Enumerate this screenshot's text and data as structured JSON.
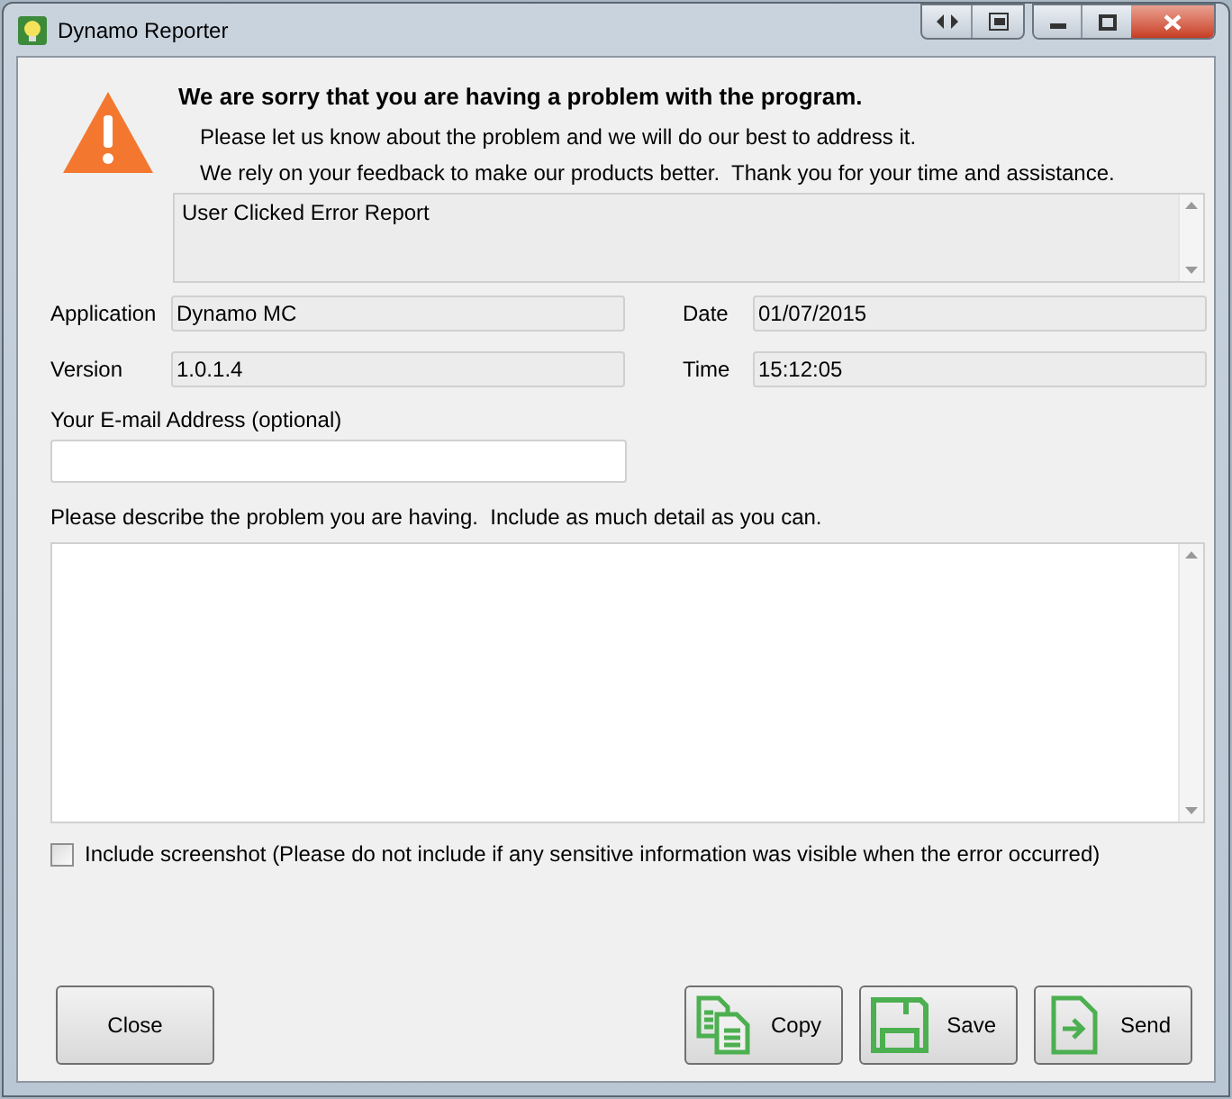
{
  "window": {
    "title": "Dynamo Reporter"
  },
  "header": {
    "heading": "We are sorry that you are having a problem with the program.",
    "lines": [
      "Please let us know about the problem and we will do our best to address it.",
      "We rely on your feedback to make our products better.  Thank you for your time and assistance."
    ]
  },
  "error_details": {
    "value": "User Clicked Error Report"
  },
  "info_fields": [
    {
      "label": "Application",
      "value": "Dynamo MC"
    },
    {
      "label": "Date",
      "value": "01/07/2015"
    },
    {
      "label": "Version",
      "value": "1.0.1.4"
    },
    {
      "label": "Time",
      "value": "15:12:05"
    }
  ],
  "email": {
    "label": "Your E-mail Address (optional)"
  },
  "description": {
    "label": "Please describe the problem you are having.  Include as much detail as you can."
  },
  "screenshot_option": {
    "label": "Include screenshot (Please do not include if any sensitive information was visible when the error occurred)",
    "checked": false
  },
  "buttons": [
    {
      "label": "Close",
      "kind": "plain"
    },
    {
      "label": "Copy",
      "kind": "copy"
    },
    {
      "label": "Save",
      "kind": "save"
    },
    {
      "label": "Send",
      "kind": "send"
    }
  ]
}
